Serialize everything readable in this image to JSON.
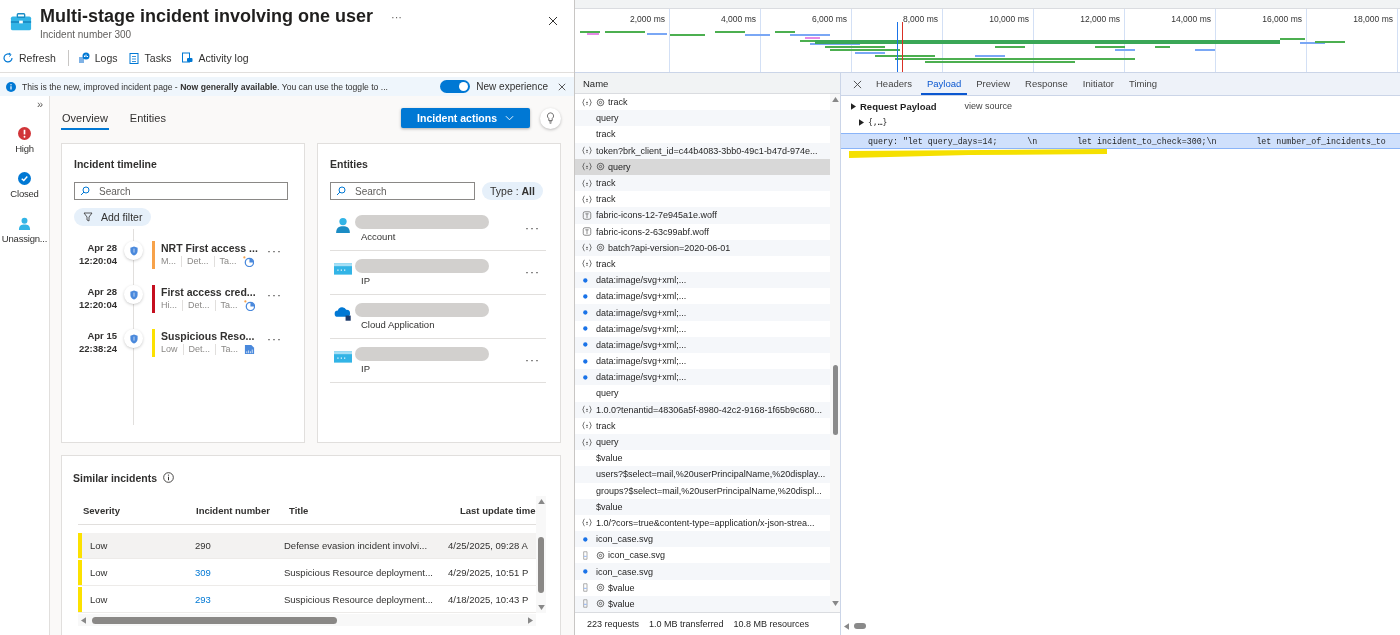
{
  "incident": {
    "title": "Multi-stage incident involving one user",
    "more": "···",
    "subtitle": "Incident number 300"
  },
  "toolbar": [
    {
      "label": "Refresh",
      "kind": "refresh"
    },
    {
      "label": "Logs",
      "kind": "logs"
    },
    {
      "label": "Tasks",
      "kind": "tasks"
    },
    {
      "label": "Activity log",
      "kind": "activity"
    }
  ],
  "banner": {
    "text": "This is the new, improved incident page - **Now generally available**. You can use the toggle to ...",
    "toggle_on": true,
    "toggle_label": "New experience"
  },
  "rail": {
    "expand_glyph": "»",
    "items": [
      {
        "label": "High",
        "kind": "severity"
      },
      {
        "label": "Closed",
        "kind": "status"
      },
      {
        "label": "Unassign...",
        "kind": "owner"
      }
    ]
  },
  "tabs": [
    {
      "label": "Overview",
      "selected": true
    },
    {
      "label": "Entities",
      "selected": false
    }
  ],
  "actions_button": "Incident actions",
  "timeline": {
    "title": "Incident timeline",
    "search_placeholder": "Search",
    "filter_label": "Add filter",
    "items": [
      {
        "date": "Apr 28",
        "time": "12:20:04",
        "title": "NRT First access ...",
        "color": "#f7a24a",
        "meta": [
          "M...",
          "Det...",
          "Ta..."
        ],
        "kind": "pie",
        "more": "···"
      },
      {
        "date": "Apr 28",
        "time": "12:20:04",
        "title": "First access cred...",
        "color": "#c50f1f",
        "meta": [
          "Hi...",
          "Det...",
          "Ta..."
        ],
        "kind": "pie",
        "more": "···"
      },
      {
        "date": "Apr 15",
        "time": "22:38:24",
        "title": "Suspicious Reso...",
        "color": "#fce100",
        "meta": [
          "Low",
          "Det...",
          "Ta..."
        ],
        "kind": "building",
        "more": "···"
      }
    ]
  },
  "entities": {
    "title": "Entities",
    "search_placeholder": "Search",
    "type_filter": "Type : **All**",
    "items": [
      {
        "type": "Account",
        "kind": "account",
        "more": "···"
      },
      {
        "type": "IP",
        "kind": "ip",
        "more": "···"
      },
      {
        "type": "Cloud Application",
        "kind": "cloud"
      },
      {
        "type": "IP",
        "kind": "ip",
        "more": "···"
      }
    ]
  },
  "similar": {
    "title": "Similar incidents",
    "columns": [
      "Severity",
      "Incident number",
      "Title",
      "Last update time"
    ],
    "rows": [
      {
        "severity": "Low",
        "color": "#fce100",
        "number": "290",
        "title": "Defense evasion incident involvi...",
        "updated": "4/25/2025, 09:28 A",
        "selected": true
      },
      {
        "severity": "Low",
        "color": "#fce100",
        "number": "309",
        "title": "Suspicious Resource deployment...",
        "updated": "4/29/2025, 10:51 P",
        "selected": false
      },
      {
        "severity": "Low",
        "color": "#fce100",
        "number": "293",
        "title": "Suspicious Resource deployment...",
        "updated": "4/18/2025, 10:43 P",
        "selected": false
      }
    ]
  },
  "devtools": {
    "ticks": [
      "2,000 ms",
      "4,000 ms",
      "6,000 ms",
      "8,000 ms",
      "10,000 ms",
      "12,000 ms",
      "14,000 ms",
      "16,000 ms",
      "18,000 ms"
    ],
    "name_header": "Name",
    "requests": [
      {
        "name": "track",
        "kind": "fetch",
        "sw": true,
        "selected": false
      },
      {
        "name": "query",
        "kind": "none",
        "sw": false,
        "selected": false
      },
      {
        "name": "track",
        "kind": "none",
        "sw": false,
        "selected": false
      },
      {
        "name": "token?brk_client_id=c44b4083-3bb0-49c1-b47d-974e...",
        "kind": "fetch",
        "sw": false,
        "selected": false
      },
      {
        "name": "query",
        "kind": "fetch",
        "sw": true,
        "selected": true
      },
      {
        "name": "track",
        "kind": "fetch",
        "sw": false,
        "selected": false
      },
      {
        "name": "track",
        "kind": "fetch",
        "sw": false,
        "selected": false
      },
      {
        "name": "fabric-icons-12-7e945a1e.woff",
        "kind": "font",
        "sw": false,
        "selected": false
      },
      {
        "name": "fabric-icons-2-63c99abf.woff",
        "kind": "font",
        "sw": false,
        "selected": false
      },
      {
        "name": "batch?api-version=2020-06-01",
        "kind": "fetch",
        "sw": true,
        "selected": false
      },
      {
        "name": "track",
        "kind": "fetch",
        "sw": false,
        "selected": false
      },
      {
        "name": "data:image/svg+xml;...",
        "kind": "image",
        "sw": false,
        "selected": false
      },
      {
        "name": "data:image/svg+xml;...",
        "kind": "image",
        "sw": false,
        "selected": false
      },
      {
        "name": "data:image/svg+xml;...",
        "kind": "image",
        "sw": false,
        "selected": false
      },
      {
        "name": "data:image/svg+xml;...",
        "kind": "image",
        "sw": false,
        "selected": false
      },
      {
        "name": "data:image/svg+xml;...",
        "kind": "image",
        "sw": false,
        "selected": false
      },
      {
        "name": "data:image/svg+xml;...",
        "kind": "image",
        "sw": false,
        "selected": false
      },
      {
        "name": "data:image/svg+xml;...",
        "kind": "image",
        "sw": false,
        "selected": false
      },
      {
        "name": "query",
        "kind": "none",
        "sw": false,
        "selected": false
      },
      {
        "name": "1.0.0?tenantid=48306a5f-8980-42c2-9168-1f65b9c680...",
        "kind": "fetch",
        "sw": false,
        "selected": false
      },
      {
        "name": "track",
        "kind": "fetch",
        "sw": false,
        "selected": false
      },
      {
        "name": "query",
        "kind": "fetch",
        "sw": false,
        "selected": false
      },
      {
        "name": "$value",
        "kind": "none",
        "sw": false,
        "selected": false
      },
      {
        "name": "users?$select=mail,%20userPrincipalName,%20display...",
        "kind": "none",
        "sw": false,
        "selected": false
      },
      {
        "name": "groups?$select=mail,%20userPrincipalName,%20displ...",
        "kind": "none",
        "sw": false,
        "selected": false
      },
      {
        "name": "$value",
        "kind": "none",
        "sw": false,
        "selected": false
      },
      {
        "name": "1.0/?cors=true&content-type=application/x-json-strea...",
        "kind": "fetch",
        "sw": false,
        "selected": false
      },
      {
        "name": "icon_case.svg",
        "kind": "image",
        "sw": false,
        "selected": false
      },
      {
        "name": "icon_case.svg",
        "kind": "doc",
        "sw": true,
        "selected": false
      },
      {
        "name": "icon_case.svg",
        "kind": "image",
        "sw": false,
        "selected": false
      },
      {
        "name": "$value",
        "kind": "doc",
        "sw": true,
        "selected": false
      },
      {
        "name": "$value",
        "kind": "doc",
        "sw": true,
        "selected": false
      }
    ],
    "summary": [
      "223 requests",
      "1.0 MB transferred",
      "10.8 MB resources"
    ],
    "tabs": [
      {
        "label": "Headers",
        "selected": false
      },
      {
        "label": "Payload",
        "selected": true
      },
      {
        "label": "Preview",
        "selected": false
      },
      {
        "label": "Response",
        "selected": false
      },
      {
        "label": "Initiator",
        "selected": false
      },
      {
        "label": "Timing",
        "selected": false
      }
    ],
    "payload": {
      "title": "Request Payload",
      "view_source": "view source",
      "collapsed": "{,…}",
      "query_key": "query:",
      "query_value": "\"let query_days=14;      \\n        let incident_to_check=300;\\n        let number_of_incidents_to"
    }
  }
}
